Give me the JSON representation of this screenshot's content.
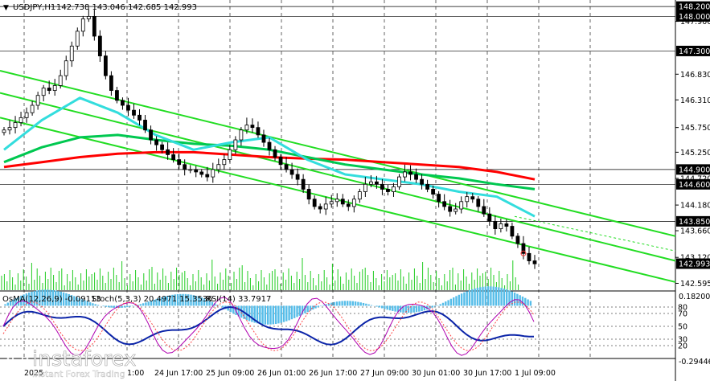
{
  "chart_data": {
    "type": "candlestick",
    "symbol_title": "USDJPY,H1",
    "ohlc_label": "142.738 143.046 142.685 142.993",
    "main_panel": {
      "ylim": [
        142.44,
        148.3
      ],
      "ticks": [
        142.595,
        143.12,
        143.66,
        144.18,
        144.72,
        145.25,
        145.75,
        146.31,
        146.83,
        147.9
      ],
      "price_tags": [
        {
          "label": "148.200",
          "value": 148.2
        },
        {
          "label": "148.000",
          "value": 148.0
        },
        {
          "label": "147.300",
          "value": 147.3
        },
        {
          "label": "144.900",
          "value": 144.9
        },
        {
          "label": "144.600",
          "value": 144.6
        },
        {
          "label": "143.850",
          "value": 143.85
        },
        {
          "label": "142.993",
          "value": 142.993
        }
      ],
      "horizontal_levels": [
        148.2,
        148.0,
        147.3,
        144.9,
        144.6,
        143.85
      ],
      "close_series": [
        145.7,
        145.75,
        145.85,
        145.95,
        146.05,
        146.2,
        146.4,
        146.55,
        146.5,
        146.6,
        146.8,
        147.1,
        147.4,
        147.7,
        147.95,
        148.0,
        147.6,
        147.2,
        146.8,
        146.5,
        146.3,
        146.2,
        146.1,
        146.0,
        145.9,
        145.7,
        145.5,
        145.4,
        145.3,
        145.2,
        145.1,
        145.0,
        144.9,
        144.9,
        144.85,
        144.8,
        144.75,
        144.9,
        145.0,
        145.1,
        145.3,
        145.5,
        145.7,
        145.8,
        145.75,
        145.6,
        145.45,
        145.3,
        145.15,
        145.0,
        144.9,
        144.8,
        144.7,
        144.5,
        144.3,
        144.15,
        144.1,
        144.2,
        144.25,
        144.3,
        144.2,
        144.15,
        144.3,
        144.45,
        144.6,
        144.65,
        144.6,
        144.5,
        144.45,
        144.55,
        144.75,
        144.85,
        144.8,
        144.7,
        144.6,
        144.5,
        144.4,
        144.25,
        144.15,
        144.05,
        144.1,
        144.25,
        144.35,
        144.3,
        144.15,
        144.0,
        143.85,
        143.7,
        143.8,
        143.75,
        143.55,
        143.4,
        143.2,
        143.05,
        142.99
      ]
    },
    "ma_series": [
      {
        "color": "#ff0000",
        "values": [
          144.95,
          145.05,
          145.15,
          145.22,
          145.25,
          145.25,
          145.2,
          145.15,
          145.12,
          145.1,
          145.05,
          145.0,
          144.95,
          144.85,
          144.7
        ]
      },
      {
        "color": "#00c850",
        "values": [
          145.05,
          145.35,
          145.55,
          145.6,
          145.5,
          145.42,
          145.38,
          145.3,
          145.15,
          145.0,
          144.9,
          144.8,
          144.72,
          144.6,
          144.5
        ]
      },
      {
        "color": "#33dddd",
        "values": [
          145.3,
          145.9,
          146.35,
          146.05,
          145.6,
          145.3,
          145.45,
          145.55,
          145.1,
          144.8,
          144.7,
          144.6,
          144.45,
          144.35,
          143.95
        ]
      }
    ],
    "channels": [
      {
        "color": "#22dd22",
        "from": [
          0,
          146.9
        ],
        "to": [
          1,
          143.55
        ]
      },
      {
        "color": "#22dd22",
        "from": [
          0,
          146.45
        ],
        "to": [
          1,
          143.05
        ]
      },
      {
        "color": "#22dd22",
        "from": [
          0,
          145.95
        ],
        "to": [
          1,
          142.62
        ]
      }
    ],
    "osma": {
      "label": "OsMA(12,26,9) -0.09113",
      "ticks": [
        "0.182001",
        "-0.29446"
      ]
    },
    "stoch": {
      "label": "Stoch(5,3,3) 20.4971 15.3536",
      "levels": [
        80,
        20
      ]
    },
    "rsi": {
      "label": "RSI(14) 33.7917",
      "levels": [
        70,
        50,
        30
      ]
    },
    "lower_ticks": [
      "80",
      "70",
      "50",
      "30",
      "20"
    ],
    "time_labels": [
      "24 Jun 17:00",
      "25 Jun 09:00",
      "26 Jun 01:00",
      "26 Jun 17:00",
      "27 Jun 09:00",
      "30 Jun 01:00",
      "30 Jun 17:00",
      "1 Jul 09:00"
    ],
    "time_partial_left": [
      "2025",
      "1:00"
    ]
  },
  "watermark": {
    "brand": "instaforex",
    "tagline": "Instant Forex Trading"
  },
  "colors": {
    "ma_slow": "#ff0000",
    "ma_mid": "#00c850",
    "ma_fast": "#33dddd",
    "channel": "#22dd22",
    "osma_bar": "#56bde9",
    "rsi": "#0b24a8",
    "stoch_main": "#b000b0",
    "stoch_signal": "#ff4444",
    "tag_bg": "#000000",
    "grid": "#000000"
  }
}
